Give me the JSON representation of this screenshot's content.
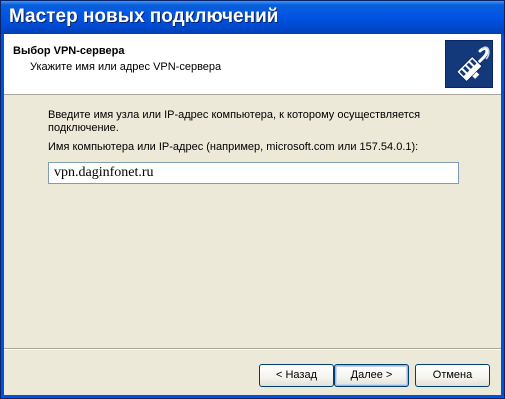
{
  "window": {
    "title": "Мастер новых подключений"
  },
  "header": {
    "title": "Выбор VPN-сервера",
    "subtitle": "Укажите имя или адрес VPN-сервера",
    "icon": "network-cable-icon"
  },
  "body": {
    "intro": "Введите имя узла или IP-адрес компьютера,  к  которому осуществляется подключение.",
    "field_label": "Имя компьютера или IP-адрес (например, microsoft.com или 157.54.0.1):",
    "host_value": "vpn.daginfonet.ru"
  },
  "buttons": {
    "back": "< Назад",
    "next": "Далее >",
    "cancel": "Отмена"
  },
  "colors": {
    "titlebar": "#0055e5",
    "frame": "#0052de",
    "dialog_bg": "#ece9d8",
    "header_bg": "#ffffff",
    "icon_bg": "#14397a"
  }
}
